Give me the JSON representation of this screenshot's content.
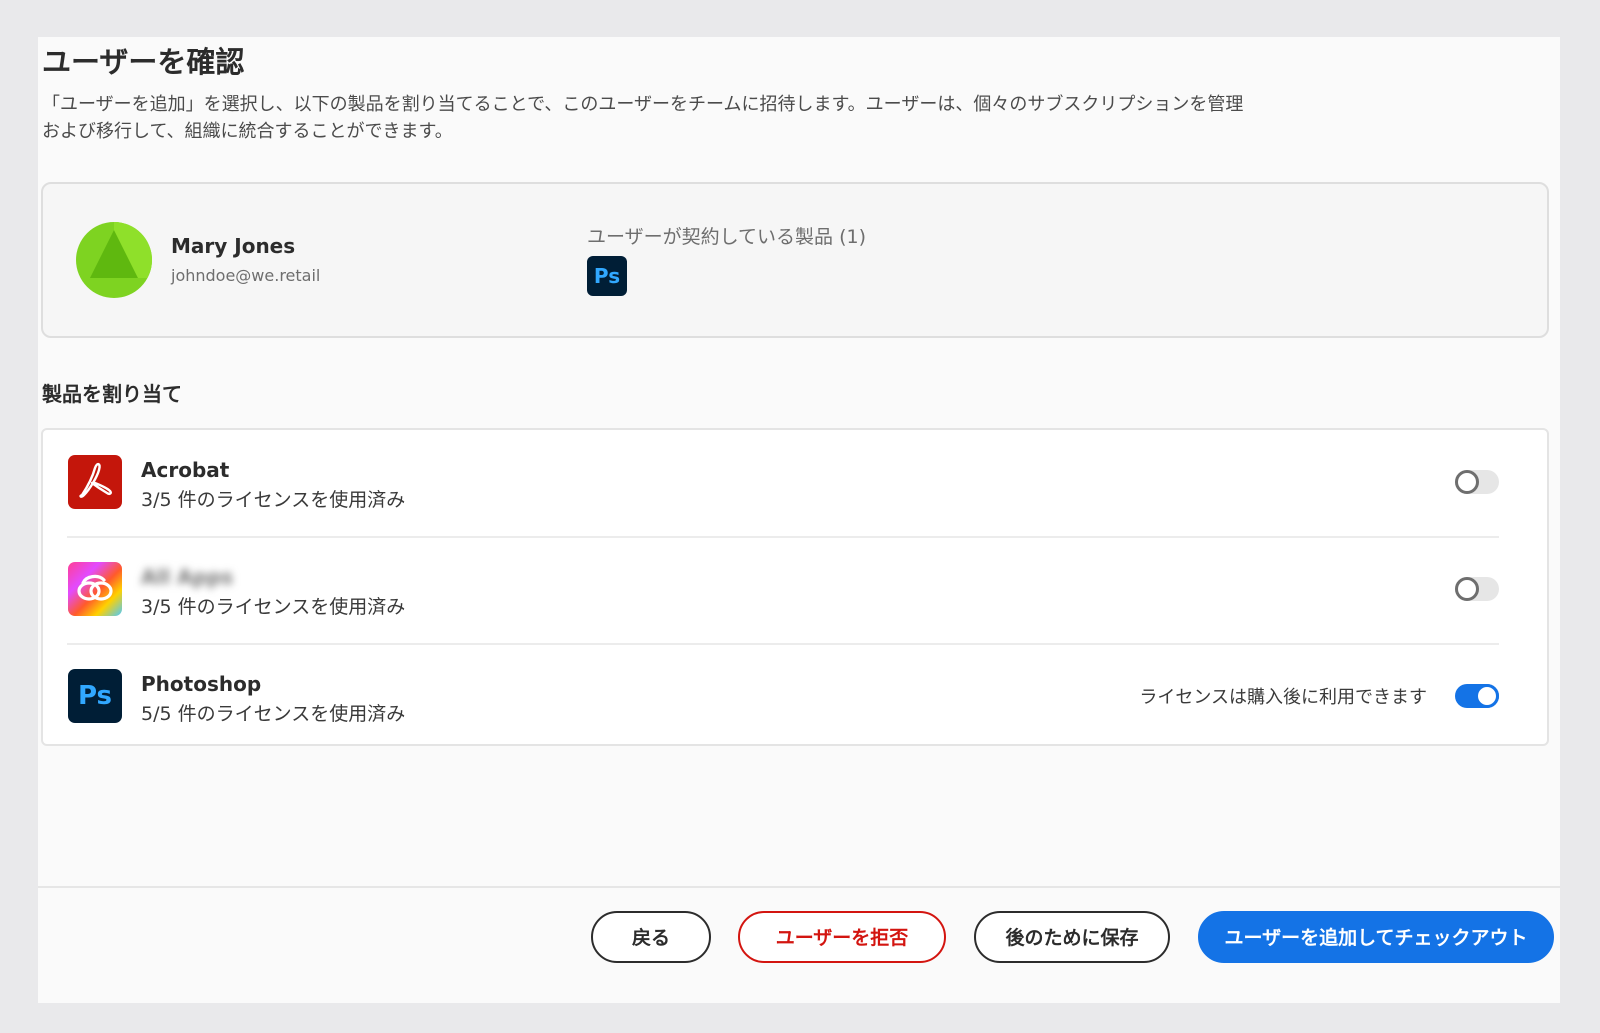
{
  "dialog": {
    "title": "ユーザーを確認",
    "description_line1": "「ユーザーを追加」を選択し、以下の製品を割り当てることで、このユーザーをチームに招待します。ユーザーは、個々のサブスクリプションを管理",
    "description_line2": "および移行して、組織に統合することができます。"
  },
  "user": {
    "name": "Mary Jones",
    "email": "johndoe@we.retail",
    "owned_products_label": "ユーザーが契約している製品 (1)",
    "owned_products": [
      {
        "icon": "photoshop-icon",
        "abbr": "Ps"
      }
    ]
  },
  "assign": {
    "heading": "製品を割り当て",
    "products": [
      {
        "name": "Acrobat",
        "usage": "3/5 件のライセンスを使用済み",
        "icon": "acrobat-icon",
        "enabled": false,
        "note": ""
      },
      {
        "name": "All Apps",
        "usage": "3/5 件のライセンスを使用済み",
        "icon": "creative-cloud-icon",
        "enabled": false,
        "note": ""
      },
      {
        "name": "Photoshop",
        "usage": "5/5 件のライセンスを使用済み",
        "icon": "photoshop-icon",
        "abbr": "Ps",
        "enabled": true,
        "note": "ライセンスは購入後に利用できます"
      }
    ]
  },
  "footer": {
    "back_label": "戻る",
    "reject_label": "ユーザーを拒否",
    "save_label": "後のために保存",
    "primary_label": "ユーザーを追加してチェックアウト"
  },
  "colors": {
    "accent": "#1473e6",
    "danger": "#d31510",
    "avatar": "#7ed321",
    "acrobat": "#c4160b",
    "photoshop_bg": "#001e36",
    "photoshop_fg": "#31a8ff"
  }
}
